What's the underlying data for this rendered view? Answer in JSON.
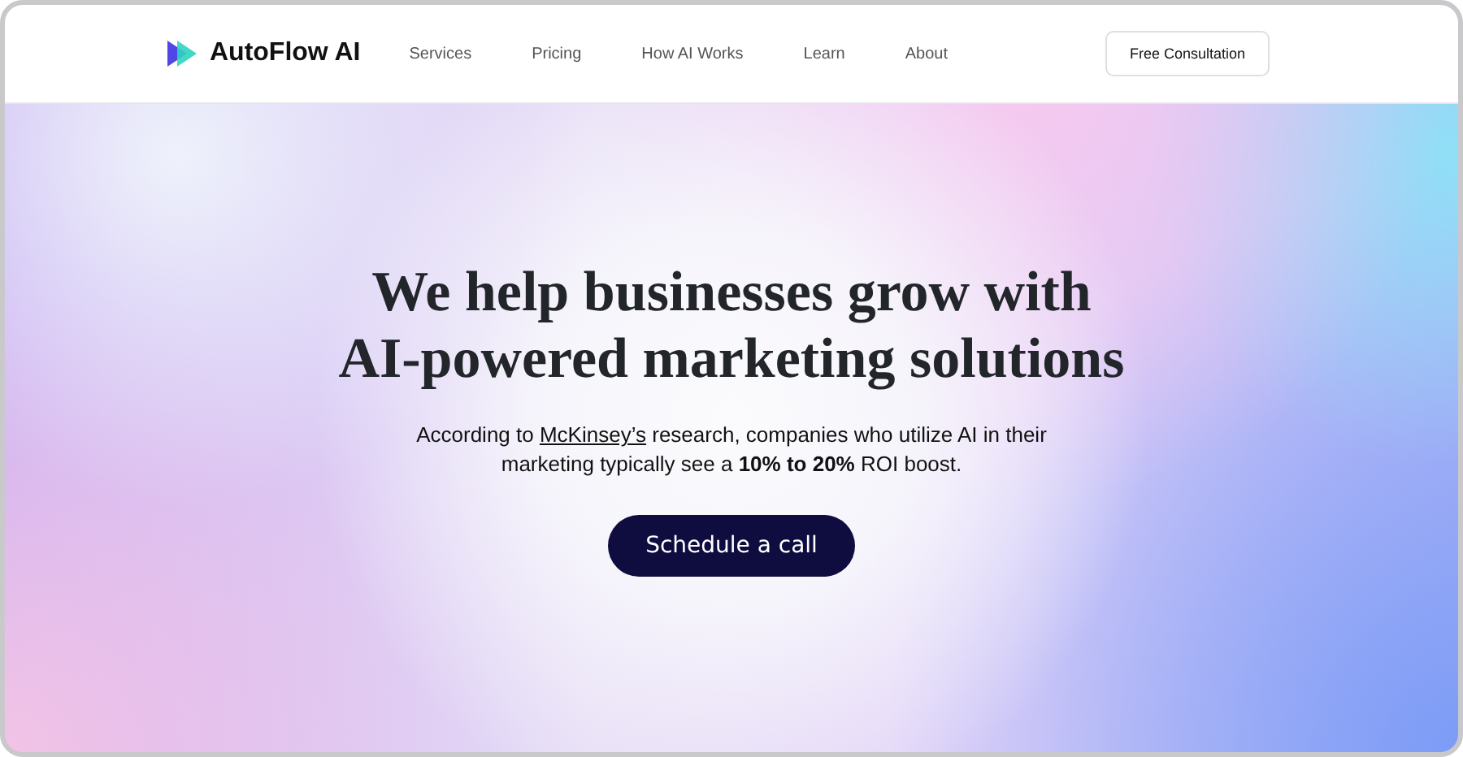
{
  "brand": {
    "name": "AutoFlow AI"
  },
  "nav": [
    {
      "label": "Services"
    },
    {
      "label": "Pricing"
    },
    {
      "label": "How AI Works"
    },
    {
      "label": "Learn"
    },
    {
      "label": "About"
    }
  ],
  "cta_button": "Free Consultation",
  "hero": {
    "headline_lines": [
      "We help businesses grow with",
      "AI-powered marketing solutions"
    ],
    "text_before": "According to",
    "link": "McKinsey’s",
    "text_after": "research, companies who utilize AI in their marketing typically see a **10% to 20%** ROI boost.",
    "button": "Schedule a call"
  }
}
